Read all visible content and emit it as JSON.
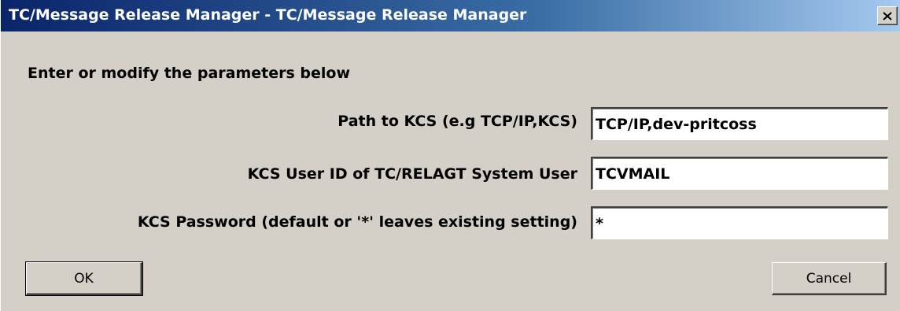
{
  "window": {
    "title": "TC/Message Release Manager - TC/Message Release Manager",
    "close_icon": "close-icon"
  },
  "form": {
    "instructions": "Enter or modify the parameters below",
    "fields": [
      {
        "label": "Path to KCS (e.g TCP/IP,KCS)",
        "value": "TCP/IP,dev-pritcoss"
      },
      {
        "label": "KCS User ID of TC/RELAGT System User",
        "value": "TCVMAIL"
      },
      {
        "label": "KCS Password (default or '*' leaves existing setting)",
        "value": "*"
      }
    ]
  },
  "buttons": {
    "ok_label": "OK",
    "cancel_label": "Cancel"
  },
  "colors": {
    "face": "#d4d0c8",
    "title_start": "#0a246a",
    "title_end": "#a6caf0"
  }
}
